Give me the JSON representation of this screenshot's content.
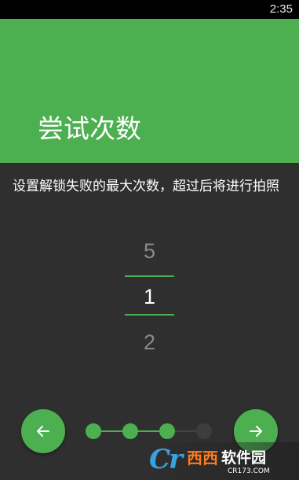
{
  "status_bar": {
    "time": "2:35"
  },
  "header": {
    "title": "尝试次数",
    "background_color": "#4caf50"
  },
  "description": "设置解锁失败的最大次数，超过后将进行拍照",
  "picker": {
    "previous_value": "5",
    "current_value": "1",
    "next_value": "2"
  },
  "navigation": {
    "back_icon": "arrow-left-icon",
    "next_icon": "arrow-right-icon",
    "total_steps": 4,
    "current_step": 3
  },
  "watermark": {
    "logo_text": "Cr",
    "brand_text": "西西",
    "site_name": "软件园",
    "url": "CR173.COM"
  },
  "colors": {
    "accent": "#4caf50",
    "background": "#2f2f2f",
    "inactive_dot": "#3d3d3d"
  }
}
